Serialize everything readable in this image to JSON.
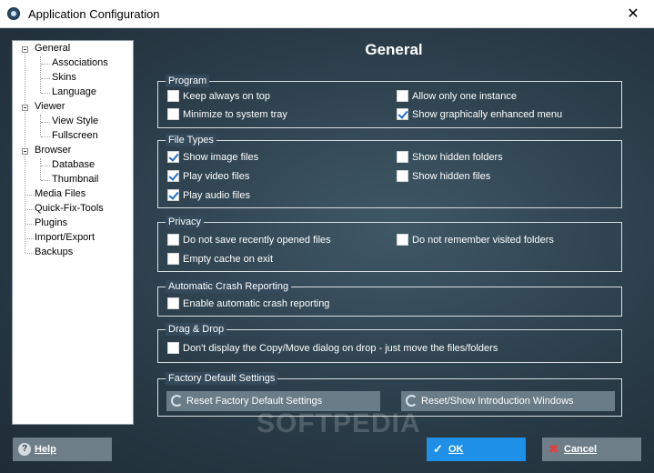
{
  "window": {
    "title": "Application Configuration",
    "close_glyph": "✕"
  },
  "tree": {
    "items": [
      {
        "label": "General",
        "level": 0,
        "expander": true,
        "selected": true
      },
      {
        "label": "Associations",
        "level": 1
      },
      {
        "label": "Skins",
        "level": 1
      },
      {
        "label": "Language",
        "level": 1
      },
      {
        "label": "Viewer",
        "level": 0,
        "expander": true
      },
      {
        "label": "View Style",
        "level": 1
      },
      {
        "label": "Fullscreen",
        "level": 1
      },
      {
        "label": "Browser",
        "level": 0,
        "expander": true
      },
      {
        "label": "Database",
        "level": 1
      },
      {
        "label": "Thumbnail",
        "level": 1
      },
      {
        "label": "Media Files",
        "level": 0
      },
      {
        "label": "Quick-Fix-Tools",
        "level": 0
      },
      {
        "label": "Plugins",
        "level": 0
      },
      {
        "label": "Import/Export",
        "level": 0
      },
      {
        "label": "Backups",
        "level": 0
      }
    ]
  },
  "page_title": "General",
  "groups": {
    "program": {
      "title": "Program",
      "options": [
        {
          "label": "Keep always on top",
          "checked": false
        },
        {
          "label": "Allow only one instance",
          "checked": false
        },
        {
          "label": "Minimize to system tray",
          "checked": false
        },
        {
          "label": "Show graphically enhanced menu",
          "checked": true
        }
      ]
    },
    "file_types": {
      "title": "File Types",
      "options": [
        {
          "label": "Show image files",
          "checked": true
        },
        {
          "label": "Show hidden folders",
          "checked": false
        },
        {
          "label": "Play video files",
          "checked": true
        },
        {
          "label": "Show hidden files",
          "checked": false
        },
        {
          "label": "Play audio files",
          "checked": true
        }
      ]
    },
    "privacy": {
      "title": "Privacy",
      "options": [
        {
          "label": "Do not save recently opened files",
          "checked": false
        },
        {
          "label": "Do not remember visited folders",
          "checked": false
        },
        {
          "label": "Empty cache on exit",
          "checked": false
        }
      ]
    },
    "crash": {
      "title": "Automatic Crash Reporting",
      "options": [
        {
          "label": "Enable automatic crash reporting",
          "checked": false
        }
      ]
    },
    "dragdrop": {
      "title": "Drag & Drop",
      "options": [
        {
          "label": "Don't display the Copy/Move dialog on drop - just move the files/folders",
          "checked": false
        }
      ]
    },
    "factory": {
      "title": "Factory Default Settings",
      "reset_label": "Reset Factory Default Settings",
      "intro_label": "Reset/Show Introduction Windows"
    }
  },
  "watermark": "SOFTPEDIA",
  "buttons": {
    "help": "Help",
    "ok": "OK",
    "cancel": "Cancel"
  },
  "icons": {
    "help": "help-icon",
    "ok": "checkmark-icon",
    "cancel": "cancel-x-icon",
    "reset": "refresh-icon"
  },
  "colors": {
    "ok_button": "#1e90e8",
    "cancel_button": "#6e7e89",
    "help_button": "#6e7e89",
    "checkmark": "#1e6fd0"
  }
}
